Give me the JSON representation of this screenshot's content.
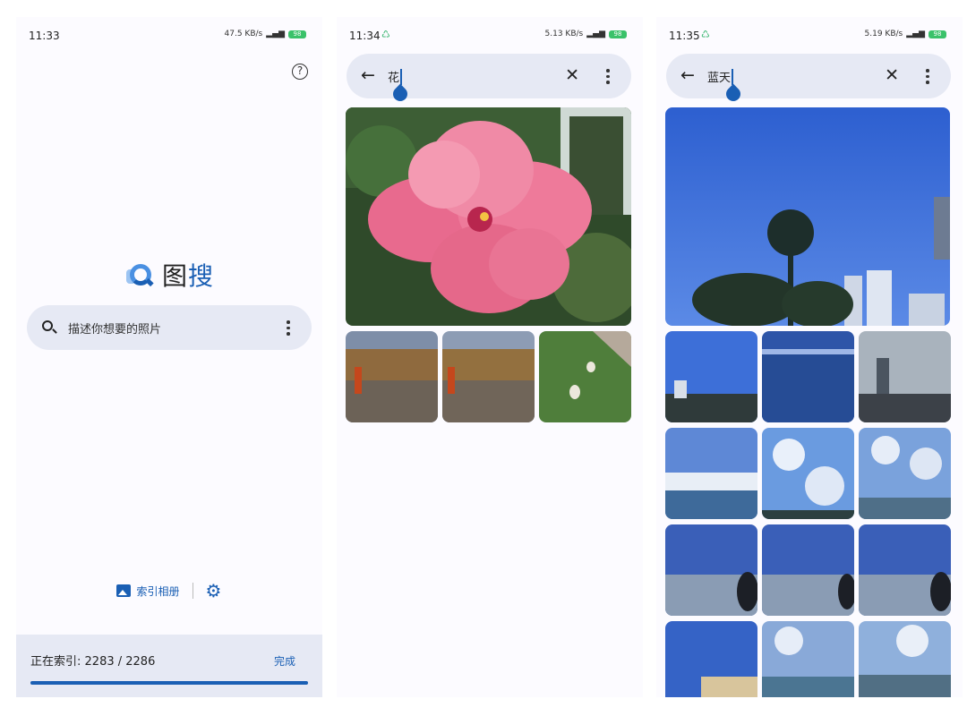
{
  "phones": [
    {
      "time": "11:33",
      "net_speed": "47.5 KB/s",
      "battery": "98",
      "help_glyph": "?",
      "app_name_a": "图",
      "app_name_b": "搜",
      "search_placeholder": "描述你想要的照片",
      "index_album_label": "索引相册",
      "index_status_label": "正在索引:",
      "index_count": "2283 / 2286",
      "index_progress": 0.9987,
      "done_label": "完成"
    },
    {
      "time": "11:34",
      "net_speed": "5.13 KB/s",
      "battery": "98",
      "query": "花",
      "results": 4
    },
    {
      "time": "11:35",
      "net_speed": "5.19 KB/s",
      "battery": "98",
      "query": "蓝天",
      "results": 13
    }
  ],
  "icons": {
    "back": "arrow-left-icon",
    "clear": "close-icon",
    "more": "more-vert-icon",
    "search": "search-icon",
    "settings": "gear-icon",
    "album": "image-icon",
    "help": "help-circle-icon"
  },
  "colors": {
    "accent": "#1a5fb4",
    "surface": "#e6e9f4",
    "background": "#fcfbff"
  }
}
